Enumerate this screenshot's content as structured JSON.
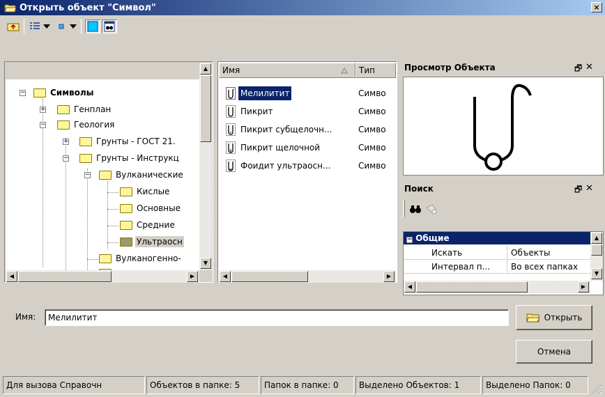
{
  "window": {
    "title": "Открыть объект \"Символ\"",
    "close_glyph": "×"
  },
  "toolbar": {
    "buttons": [
      {
        "icon": "folder-up-icon"
      },
      {
        "icon": "list-view-icon"
      },
      {
        "icon": "dropdown-arrow-icon"
      },
      {
        "icon": "small-icons-icon"
      },
      {
        "icon": "dropdown-arrow-icon"
      },
      {
        "icon": "preview-toggle-icon"
      },
      {
        "icon": "search-binoculars-icon"
      }
    ]
  },
  "tree": {
    "items": [
      {
        "label": "Символы",
        "bold": true
      },
      {
        "label": "Генплан"
      },
      {
        "label": "Геология"
      },
      {
        "label": "Грунты - ГОСТ 21."
      },
      {
        "label": "Грунты - Инструкц"
      },
      {
        "label": "Вулканические"
      },
      {
        "label": "Кислые"
      },
      {
        "label": "Основные"
      },
      {
        "label": "Средние"
      },
      {
        "label": "Ультраосн"
      },
      {
        "label": "Вулканогенно-"
      }
    ]
  },
  "list": {
    "columns": {
      "name": "Имя",
      "type": "Тип"
    },
    "rows": [
      {
        "name": "Мелилитит",
        "type": "Симво"
      },
      {
        "name": "Пикрит",
        "type": "Симво"
      },
      {
        "name": "Пикрит субщелочн...",
        "type": "Симво"
      },
      {
        "name": "Пикрит щелочной",
        "type": "Симво"
      },
      {
        "name": "Фоидит ультраосн...",
        "type": "Симво"
      }
    ]
  },
  "preview": {
    "title": "Просмотр Объекта",
    "pin_glyph": "🗗",
    "close_glyph": "✕"
  },
  "search": {
    "title": "Поиск",
    "pin_glyph": "🗗",
    "close_glyph": "✕",
    "category": "Общие",
    "category_glyph": "−",
    "props": [
      {
        "key": "Искать",
        "value": "Объекты"
      },
      {
        "key": "Интервал п...",
        "value": "Во всех папках"
      }
    ]
  },
  "form": {
    "name_label": "Имя:",
    "name_value": "Мелилитит",
    "open_button": "Открыть",
    "cancel_button": "Отмена"
  },
  "status": [
    "Для вызова Справочн",
    "Объектов в папке: 5",
    "Папок в папке: 0",
    "Выделено Объектов: 1",
    "Выделено Папок: 0"
  ]
}
